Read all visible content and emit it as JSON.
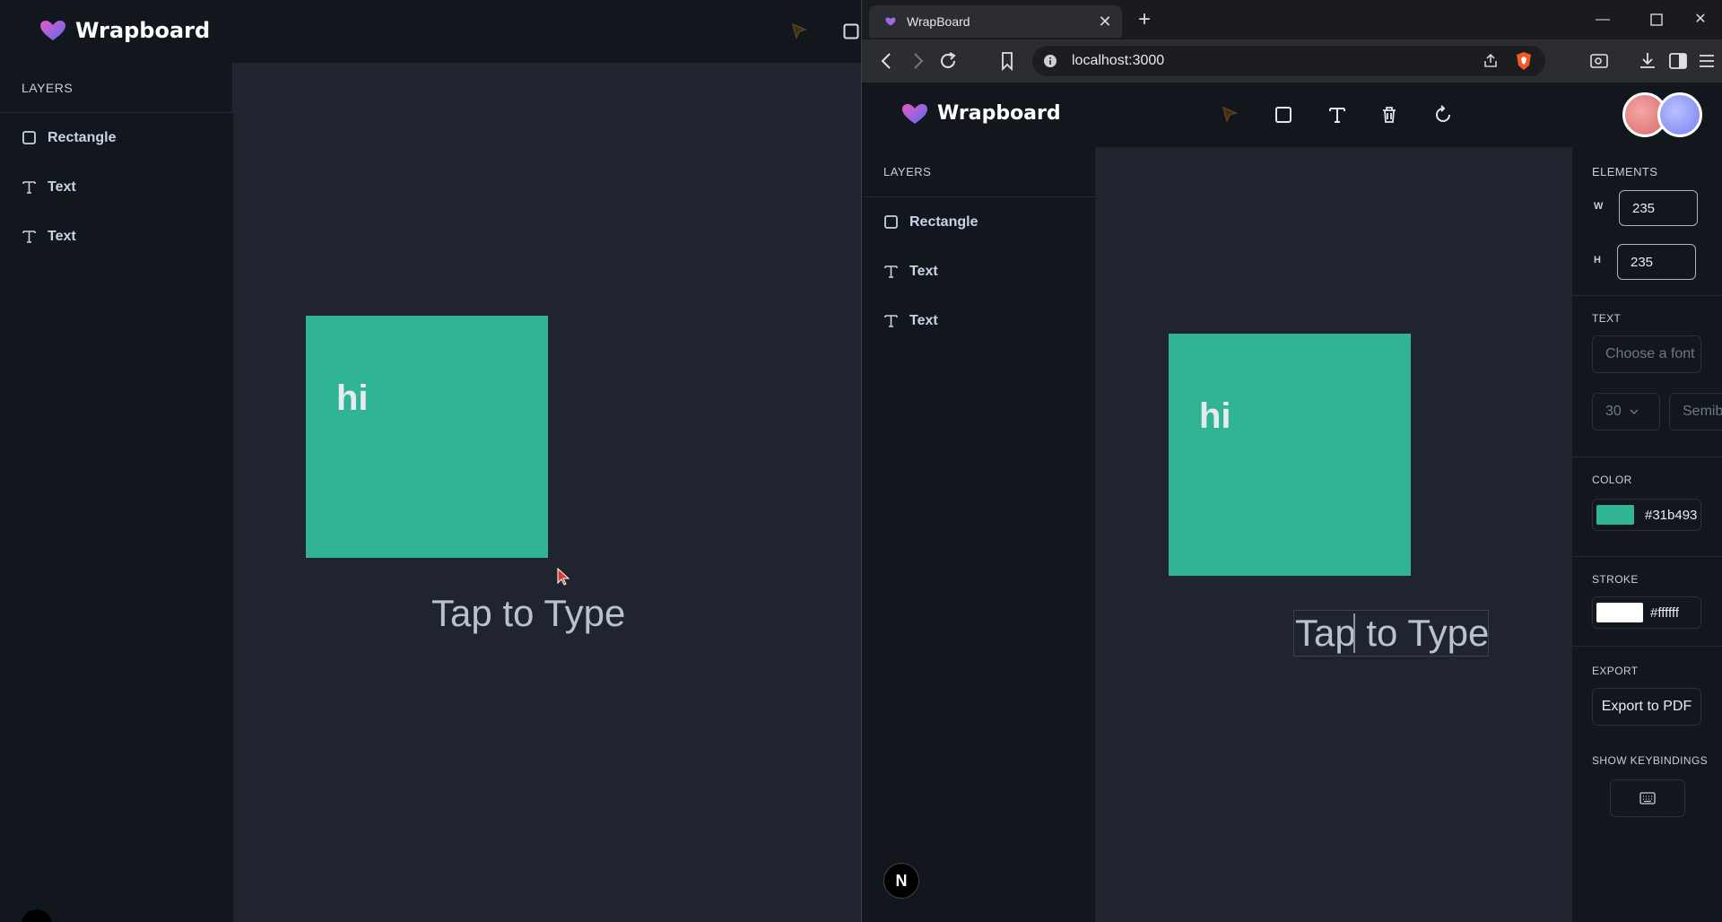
{
  "app": {
    "name": "Wrapboard",
    "layers_title": "LAYERS",
    "layers": [
      {
        "label": "Rectangle",
        "icon": "square-icon"
      },
      {
        "label": "Text",
        "icon": "text-icon"
      },
      {
        "label": "Text",
        "icon": "text-icon"
      }
    ],
    "canvas": {
      "rect_color": "#31b493",
      "rect_text": "hi",
      "placeholder_text": "Tap to Type"
    }
  },
  "browser": {
    "tab_title": "WrapBoard",
    "url": "localhost:3000"
  },
  "properties": {
    "elements_title": "ELEMENTS",
    "width_label": "W",
    "width_value": "235",
    "height_label": "H",
    "height_value": "235",
    "text_title": "TEXT",
    "font_family_placeholder": "Choose a font",
    "font_size": "30",
    "font_weight": "Semibold",
    "color_title": "COLOR",
    "fill_color": "#31b493",
    "stroke_title": "STROKE",
    "stroke_color": "#ffffff",
    "export_title": "EXPORT",
    "export_button": "Export to PDF",
    "keybindings_title": "SHOW KEYBINDINGS"
  },
  "misc": {
    "nextjs_badge": "N"
  }
}
